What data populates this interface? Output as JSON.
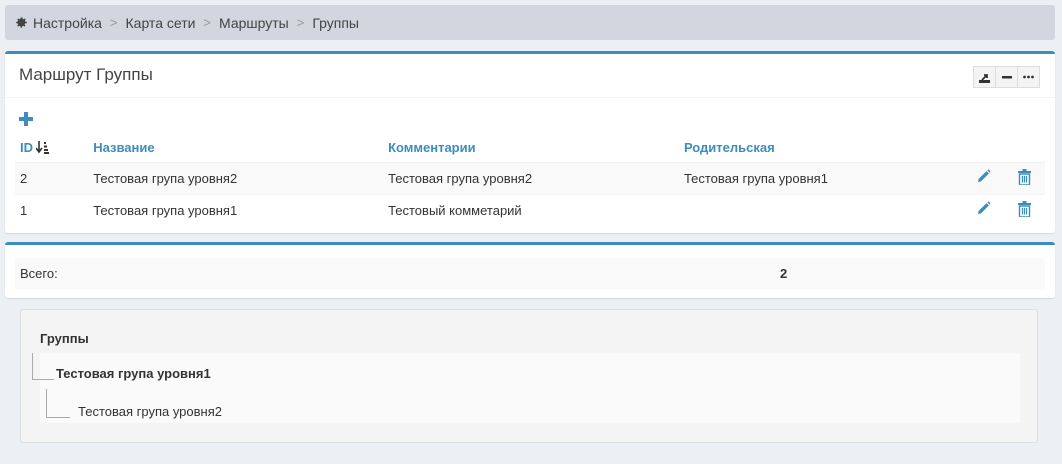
{
  "breadcrumb": {
    "items": [
      "Настройка",
      "Карта сети",
      "Маршруты",
      "Группы"
    ],
    "separator": ">"
  },
  "box": {
    "title": "Маршрут Группы",
    "tools": [
      "export-icon",
      "minus-icon",
      "more-icon"
    ]
  },
  "table": {
    "columns": [
      "ID",
      "Название",
      "Комментарии",
      "Родительская"
    ],
    "rows": [
      {
        "id": "2",
        "name": "Тестовая група уровня2",
        "comment": "Тестовая група уровня2",
        "parent": "Тестовая група уровня1"
      },
      {
        "id": "1",
        "name": "Тестовая група уровня1",
        "comment": "Тестовый комметарий",
        "parent": ""
      }
    ]
  },
  "summary": {
    "label": "Всего:",
    "value": "2"
  },
  "tree": {
    "title": "Группы",
    "root": "Тестовая група уровня1",
    "child": "Тестовая група уровня2"
  },
  "colors": {
    "accent": "#3c8dbc",
    "background": "#ecf0f5",
    "breadcrumb_bg": "#d2d6de"
  }
}
